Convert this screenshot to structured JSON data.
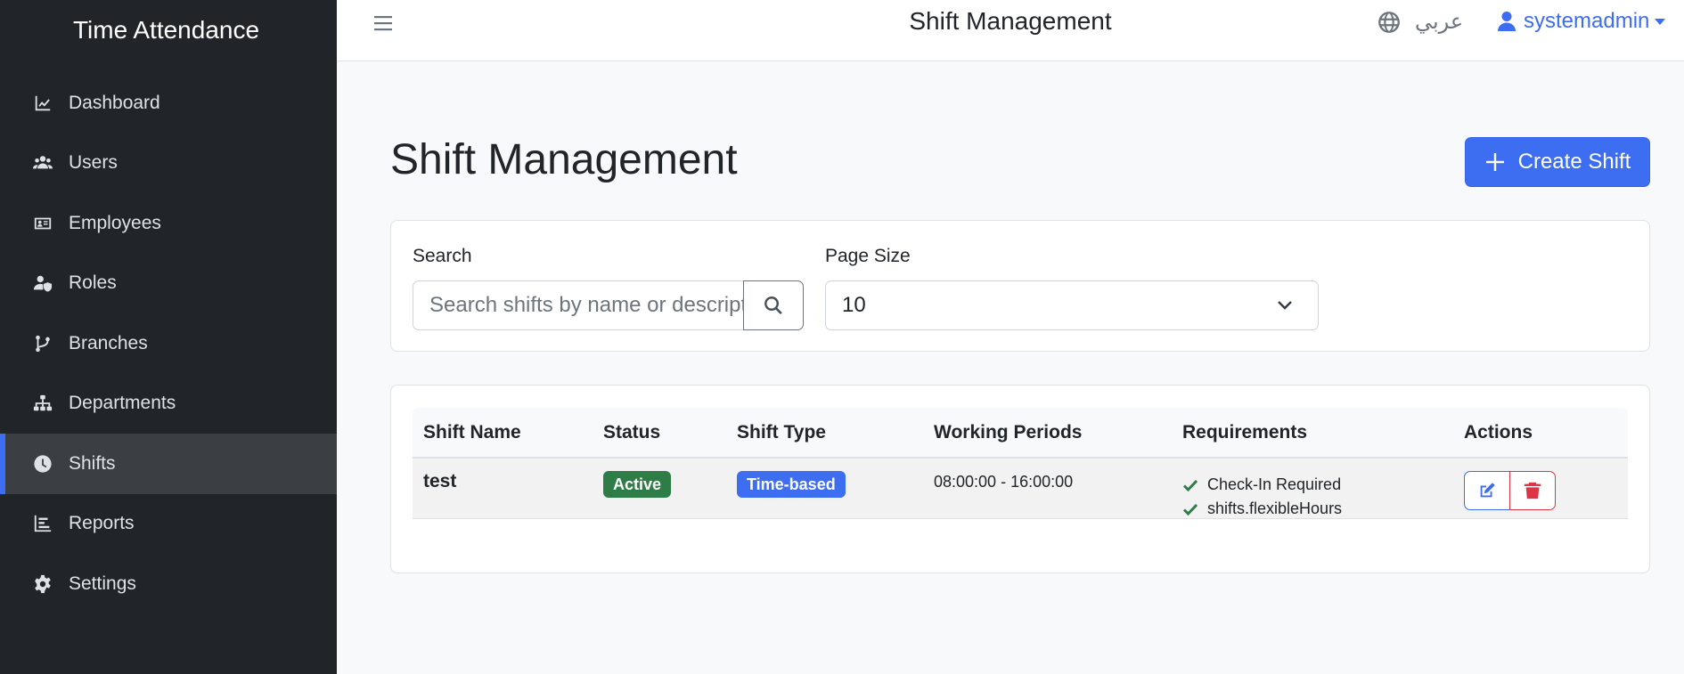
{
  "app": {
    "title": "Time Attendance"
  },
  "sidebar": {
    "items": [
      {
        "label": "Dashboard",
        "icon": "chart-line-icon",
        "active": false
      },
      {
        "label": "Users",
        "icon": "users-icon",
        "active": false
      },
      {
        "label": "Employees",
        "icon": "id-card-icon",
        "active": false
      },
      {
        "label": "Roles",
        "icon": "user-shield-icon",
        "active": false
      },
      {
        "label": "Branches",
        "icon": "code-branch-icon",
        "active": false
      },
      {
        "label": "Departments",
        "icon": "sitemap-icon",
        "active": false
      },
      {
        "label": "Shifts",
        "icon": "clock-icon",
        "active": true
      },
      {
        "label": "Reports",
        "icon": "chart-bar-icon",
        "active": false
      },
      {
        "label": "Settings",
        "icon": "gear-icon",
        "active": false
      }
    ]
  },
  "topbar": {
    "title": "Shift Management",
    "language": "عربي",
    "user": "systemadmin"
  },
  "page": {
    "title": "Shift Management",
    "create_button": "Create Shift"
  },
  "filters": {
    "search_label": "Search",
    "search_placeholder": "Search shifts by name or description...",
    "page_size_label": "Page Size",
    "page_size_value": "10"
  },
  "table": {
    "headers": [
      "Shift Name",
      "Status",
      "Shift Type",
      "Working Periods",
      "Requirements",
      "Actions"
    ],
    "rows": [
      {
        "name": "test",
        "status": "Active",
        "type": "Time-based",
        "period": "08:00:00 - 16:00:00",
        "requirements": [
          "Check-In Required",
          "shifts.flexibleHours"
        ]
      }
    ]
  },
  "colors": {
    "primary": "#3d6df0",
    "success": "#2e7d47",
    "danger": "#dc3545",
    "sidebar_bg": "#212529"
  }
}
